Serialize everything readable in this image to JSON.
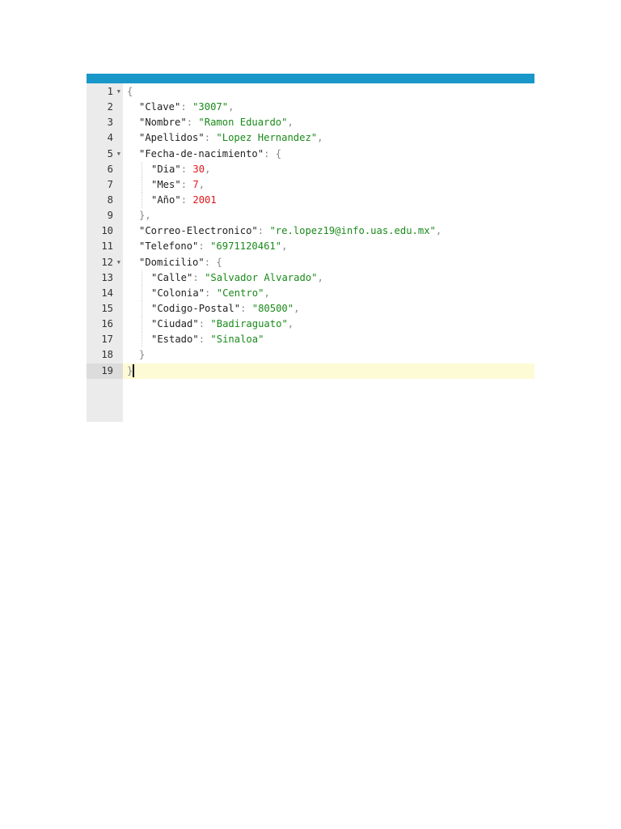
{
  "colors": {
    "header_bar": "#1a97c9",
    "key": "#222222",
    "string": "#1a8a1a",
    "number": "#e0171b",
    "punct": "#888888",
    "active_line": "#fdfbd5"
  },
  "lines": [
    {
      "num": "1",
      "indent": 0,
      "fold": true,
      "tokens": [
        {
          "t": "{",
          "c": "p"
        }
      ]
    },
    {
      "num": "2",
      "indent": 1,
      "tokens": [
        {
          "t": "\"Clave\"",
          "c": "k"
        },
        {
          "t": ": ",
          "c": "p"
        },
        {
          "t": "\"3007\"",
          "c": "s"
        },
        {
          "t": ",",
          "c": "p"
        }
      ]
    },
    {
      "num": "3",
      "indent": 1,
      "tokens": [
        {
          "t": "\"Nombre\"",
          "c": "k"
        },
        {
          "t": ": ",
          "c": "p"
        },
        {
          "t": "\"Ramon Eduardo\"",
          "c": "s"
        },
        {
          "t": ",",
          "c": "p"
        }
      ]
    },
    {
      "num": "4",
      "indent": 1,
      "tokens": [
        {
          "t": "\"Apellidos\"",
          "c": "k"
        },
        {
          "t": ": ",
          "c": "p"
        },
        {
          "t": "\"Lopez Hernandez\"",
          "c": "s"
        },
        {
          "t": ",",
          "c": "p"
        }
      ]
    },
    {
      "num": "5",
      "indent": 1,
      "fold": true,
      "tokens": [
        {
          "t": "\"Fecha-de-nacimiento\"",
          "c": "k"
        },
        {
          "t": ": {",
          "c": "p"
        }
      ]
    },
    {
      "num": "6",
      "indent": 2,
      "tokens": [
        {
          "t": "\"Dia\"",
          "c": "k"
        },
        {
          "t": ": ",
          "c": "p"
        },
        {
          "t": "30",
          "c": "n"
        },
        {
          "t": ",",
          "c": "p"
        }
      ]
    },
    {
      "num": "7",
      "indent": 2,
      "tokens": [
        {
          "t": "\"Mes\"",
          "c": "k"
        },
        {
          "t": ": ",
          "c": "p"
        },
        {
          "t": "7",
          "c": "n"
        },
        {
          "t": ",",
          "c": "p"
        }
      ]
    },
    {
      "num": "8",
      "indent": 2,
      "tokens": [
        {
          "t": "\"Año\"",
          "c": "k"
        },
        {
          "t": ": ",
          "c": "p"
        },
        {
          "t": "2001",
          "c": "n"
        }
      ]
    },
    {
      "num": "9",
      "indent": 1,
      "tokens": [
        {
          "t": "},",
          "c": "p"
        }
      ]
    },
    {
      "num": "10",
      "indent": 1,
      "tokens": [
        {
          "t": "\"Correo-Electronico\"",
          "c": "k"
        },
        {
          "t": ": ",
          "c": "p"
        },
        {
          "t": "\"re.lopez19@info.uas.edu.mx\"",
          "c": "s"
        },
        {
          "t": ",",
          "c": "p"
        }
      ]
    },
    {
      "num": "11",
      "indent": 1,
      "tokens": [
        {
          "t": "\"Telefono\"",
          "c": "k"
        },
        {
          "t": ": ",
          "c": "p"
        },
        {
          "t": "\"6971120461\"",
          "c": "s"
        },
        {
          "t": ",",
          "c": "p"
        }
      ]
    },
    {
      "num": "12",
      "indent": 1,
      "fold": true,
      "tokens": [
        {
          "t": "\"Domicilio\"",
          "c": "k"
        },
        {
          "t": ": {",
          "c": "p"
        }
      ]
    },
    {
      "num": "13",
      "indent": 2,
      "tokens": [
        {
          "t": "\"Calle\"",
          "c": "k"
        },
        {
          "t": ": ",
          "c": "p"
        },
        {
          "t": "\"Salvador Alvarado\"",
          "c": "s"
        },
        {
          "t": ",",
          "c": "p"
        }
      ]
    },
    {
      "num": "14",
      "indent": 2,
      "tokens": [
        {
          "t": "\"Colonia\"",
          "c": "k"
        },
        {
          "t": ": ",
          "c": "p"
        },
        {
          "t": "\"Centro\"",
          "c": "s"
        },
        {
          "t": ",",
          "c": "p"
        }
      ]
    },
    {
      "num": "15",
      "indent": 2,
      "tokens": [
        {
          "t": "\"Codigo-Postal\"",
          "c": "k"
        },
        {
          "t": ": ",
          "c": "p"
        },
        {
          "t": "\"80500\"",
          "c": "s"
        },
        {
          "t": ",",
          "c": "p"
        }
      ]
    },
    {
      "num": "16",
      "indent": 2,
      "tokens": [
        {
          "t": "\"Ciudad\"",
          "c": "k"
        },
        {
          "t": ": ",
          "c": "p"
        },
        {
          "t": "\"Badiraguato\"",
          "c": "s"
        },
        {
          "t": ",",
          "c": "p"
        }
      ]
    },
    {
      "num": "17",
      "indent": 2,
      "tokens": [
        {
          "t": "\"Estado\"",
          "c": "k"
        },
        {
          "t": ": ",
          "c": "p"
        },
        {
          "t": "\"Sinaloa\"",
          "c": "s"
        }
      ]
    },
    {
      "num": "18",
      "indent": 1,
      "tokens": [
        {
          "t": "}",
          "c": "p"
        }
      ]
    },
    {
      "num": "19",
      "indent": 0,
      "active": true,
      "cursor": true,
      "tokens": [
        {
          "t": "}",
          "c": "p"
        }
      ]
    }
  ]
}
